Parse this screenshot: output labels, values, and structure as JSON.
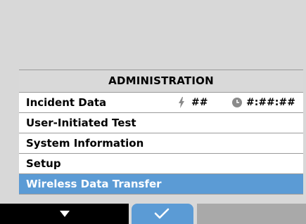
{
  "menu": {
    "header": "ADMINISTRATION",
    "items": [
      {
        "label": "Incident Data",
        "shock_value": "##",
        "time_value": "#:##:##"
      },
      {
        "label": "User-Initiated Test"
      },
      {
        "label": "System Information"
      },
      {
        "label": "Setup"
      },
      {
        "label": "Wireless Data Transfer"
      }
    ],
    "selected_index": 4
  },
  "softkeys": {
    "left_icon": "down-arrow-icon",
    "middle_icon": "check-icon",
    "right_icon": ""
  },
  "colors": {
    "selection": "#5b9bd5",
    "header_bg": "#d9d9d9",
    "screen_bg": "#d8d8d8"
  }
}
